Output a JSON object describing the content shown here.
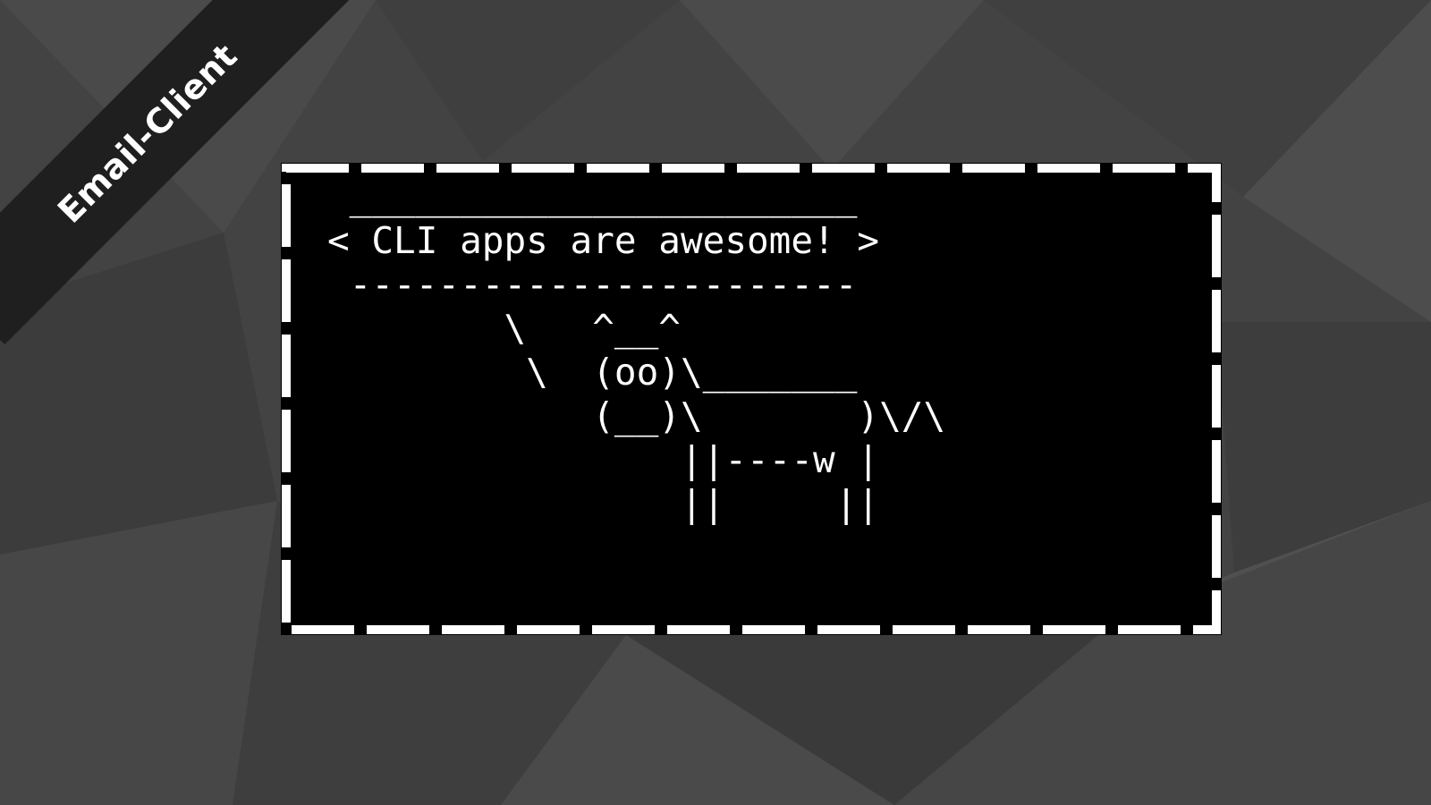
{
  "banner": {
    "label": "Email-Client"
  },
  "terminal": {
    "lines": [
      " _______________________",
      "< CLI apps are awesome! >",
      " -----------------------",
      "        \\   ^__^",
      "         \\  (oo)\\_______",
      "            (__)\\       )\\/\\",
      "                ||----w |",
      "                ||     ||"
    ]
  },
  "colors": {
    "background": "#444444",
    "banner": "#1f1f1f",
    "terminal_background": "#000000",
    "terminal_text": "#ffffff",
    "dashed_border": "#ffffff"
  }
}
